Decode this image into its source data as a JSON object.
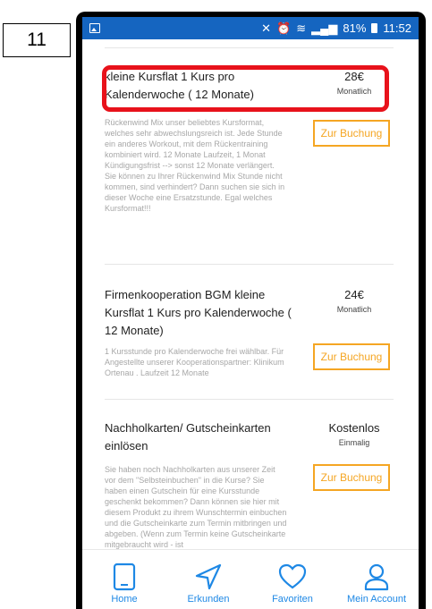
{
  "step_number": "11",
  "status_bar": {
    "battery": "81%",
    "time": "11:52"
  },
  "products": [
    {
      "title": "kleine Kursflat 1 Kurs pro Kalenderwoche ( 12 Monate)",
      "price": "28€",
      "period": "Monatlich",
      "description": "Rückenwind Mix unser beliebtes Kursformat, welches sehr abwechslungsreich ist. Jede Stunde ein anderes Workout, mit dem Rückentraining kombiniert wird. 12 Monate Laufzeit, 1 Monat Kündigungsfrist --> sonst 12 Monate verlängert. Sie können zu Ihrer Rückenwind Mix Stunde nicht kommen, sind verhindert? Dann suchen sie sich in dieser Woche eine Ersatzstunde. Egal welches Kursformat!!!",
      "button": "Zur Buchung"
    },
    {
      "title": "Firmenkooperation BGM kleine Kursflat 1 Kurs pro Kalenderwoche ( 12 Monate)",
      "price": "24€",
      "period": "Monatlich",
      "description": "1 Kursstunde pro Kalenderwoche frei wählbar. Für Angestellte unserer Kooperationspartner: Klinikum Ortenau . Laufzeit 12 Monate",
      "button": "Zur Buchung"
    },
    {
      "title": "Nachholkarten/ Gutscheinkarten einlösen",
      "price": "Kostenlos",
      "period": "Einmalig",
      "description": "Sie haben noch Nachholkarten aus unserer Zeit vor dem \"Selbsteinbuchen\" in die Kurse? Sie haben einen Gutschein für eine Kursstunde geschenkt bekommen? Dann können sie hier mit diesem Produkt zu ihrem Wunschtermin einbuchen und die Gutscheinkarte zum Termin mitbringen und abgeben. (Wenn zum Termin keine Gutscheinkarte mitgebraucht wird - ist",
      "button": "Zur Buchung"
    }
  ],
  "nav": [
    {
      "label": "Home",
      "icon": "tablet-icon"
    },
    {
      "label": "Erkunden",
      "icon": "navigation-arrow-icon"
    },
    {
      "label": "Favoriten",
      "icon": "heart-icon"
    },
    {
      "label": "Mein Account",
      "icon": "user-icon"
    }
  ],
  "colors": {
    "status_bar": "#1565c0",
    "accent_orange": "#f5a623",
    "nav_blue": "#1e88e5",
    "highlight_red": "#e8121b"
  }
}
